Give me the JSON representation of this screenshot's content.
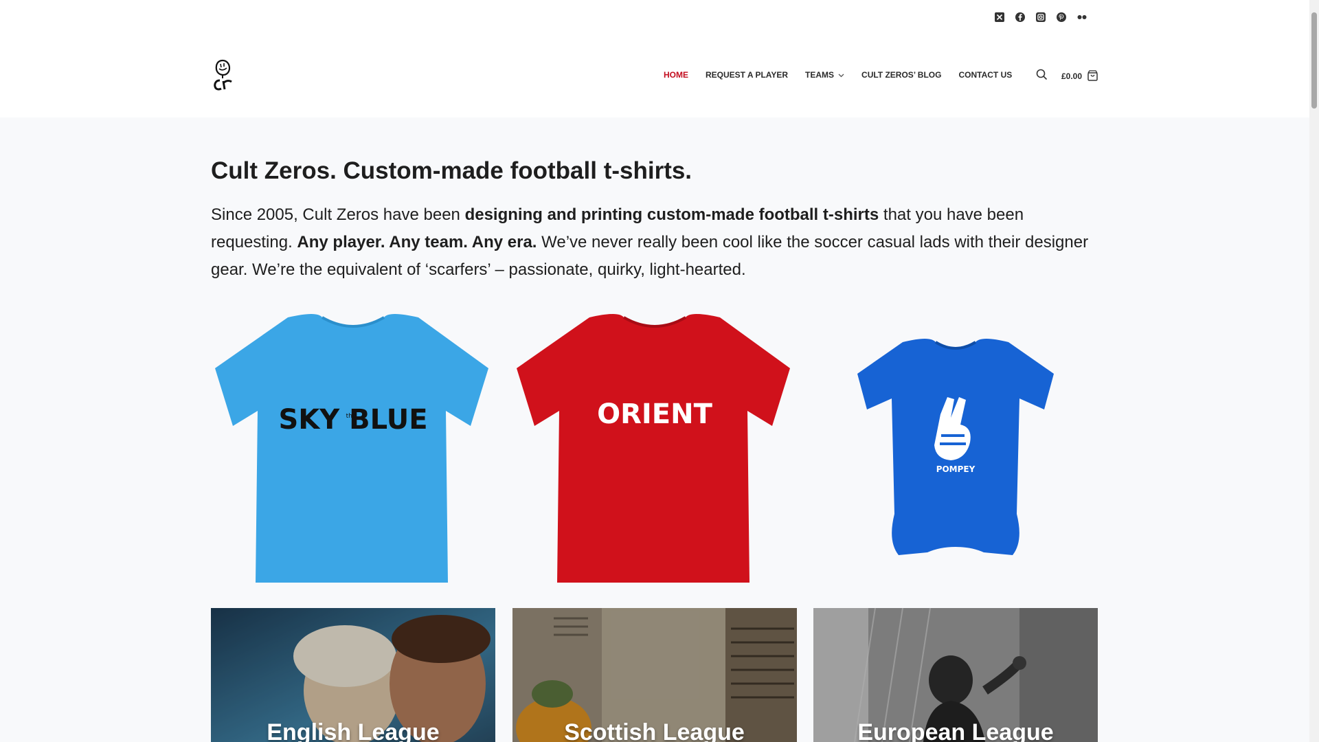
{
  "header": {
    "social_icons": [
      "x-twitter-icon",
      "facebook-icon",
      "instagram-icon",
      "pinterest-icon",
      "flickr-icon"
    ],
    "logo_icon": "cult-zeros-logo-icon",
    "nav": [
      {
        "label": "Home",
        "active": true
      },
      {
        "label": "Request a player",
        "active": false
      },
      {
        "label": "Teams",
        "active": false,
        "has_dropdown": true
      },
      {
        "label": "Cult Zeros’ Blog",
        "active": false
      },
      {
        "label": "Contact Us",
        "active": false
      }
    ],
    "search_icon": "search-icon",
    "cart": {
      "total": "£0.00",
      "icon": "shopping-bag-icon"
    }
  },
  "main": {
    "heading": "Cult Zeros. Custom-made football t-shirts.",
    "intro": {
      "p1": "Since 2005, Cult Zeros have been ",
      "b1": "designing and printing custom-made football t-shirts",
      "p2": " that you have been requesting. ",
      "b2": "Any player. Any team. Any era.",
      "p3": " We’ve never really been cool like the soccer casual lads with their designer gear. We’re the equivalent of ‘scarfers’ – passionate, quirky, light-hearted."
    },
    "products": [
      {
        "print": "SKY BLUE",
        "print_small": "the",
        "garment": "t-shirt",
        "colour": "#3ba6e6"
      },
      {
        "print": "ORIENT",
        "garment": "t-shirt",
        "colour": "#d0111b"
      },
      {
        "print": "POMPEY",
        "garment": "baby-grow",
        "colour": "#1763d4"
      }
    ],
    "leagues": [
      {
        "title": "English League"
      },
      {
        "title": "Scottish League"
      },
      {
        "title": "European League"
      }
    ]
  }
}
